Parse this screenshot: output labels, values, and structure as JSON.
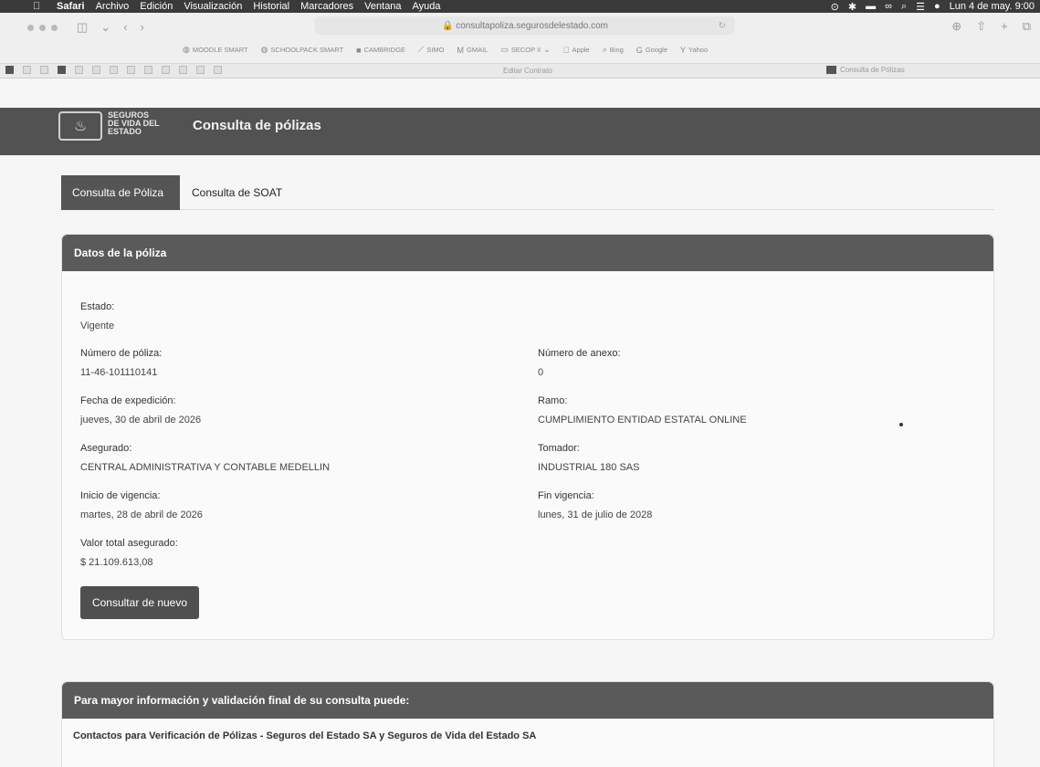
{
  "menubar": {
    "app": "Safari",
    "items": [
      "Archivo",
      "Edición",
      "Visualización",
      "Historial",
      "Marcadores",
      "Ventana",
      "Ayuda"
    ],
    "clock": "Lun 4 de may. 9:00"
  },
  "browser": {
    "url": "consultapoliza.segurosdelestado.com",
    "bookmarks": [
      "MOODLE SMART",
      "SCHOOLPACK SMART",
      "CAMBRIDGE",
      "SIMO",
      "GMAIL",
      "SECOP II",
      "Apple",
      "Bing",
      "Google",
      "Yahoo"
    ],
    "tabs": [
      "Editar Contrato",
      "Consulta de Pólizas"
    ]
  },
  "site": {
    "logo_lines": [
      "SEGUROS",
      "DE VIDA DEL",
      "ESTADO"
    ],
    "title": "Consulta de pólizas"
  },
  "page_tabs": {
    "active": "Consulta de Póliza",
    "inactive": "Consulta de SOAT"
  },
  "policy": {
    "header": "Datos de la póliza",
    "estado_label": "Estado:",
    "estado": "Vigente",
    "numero_label": "Número de póliza:",
    "numero": "11-46-101110141",
    "anexo_label": "Número de anexo:",
    "anexo": "0",
    "fecha_label": "Fecha de expedición:",
    "fecha": "jueves, 30 de abril de 2026",
    "ramo_label": "Ramo:",
    "ramo": "CUMPLIMIENTO ENTIDAD ESTATAL ONLINE",
    "asegurado_label": "Asegurado:",
    "asegurado": "CENTRAL ADMINISTRATIVA Y CONTABLE MEDELLIN",
    "tomador_label": "Tomador:",
    "tomador": "INDUSTRIAL 180 SAS",
    "inicio_label": "Inicio de vigencia:",
    "inicio": "martes, 28 de abril de 2026",
    "fin_label": "Fin vigencia:",
    "fin": "lunes, 31 de julio de 2028",
    "valor_label": "Valor total asegurado:",
    "valor": "$ 21.109.613,08",
    "button": "Consultar de nuevo"
  },
  "info": {
    "header": "Para mayor información y validación final de su consulta puede:",
    "contacts": "Contactos para Verificación de Pólizas - Seguros del Estado SA y Seguros de Vida del Estado SA"
  }
}
